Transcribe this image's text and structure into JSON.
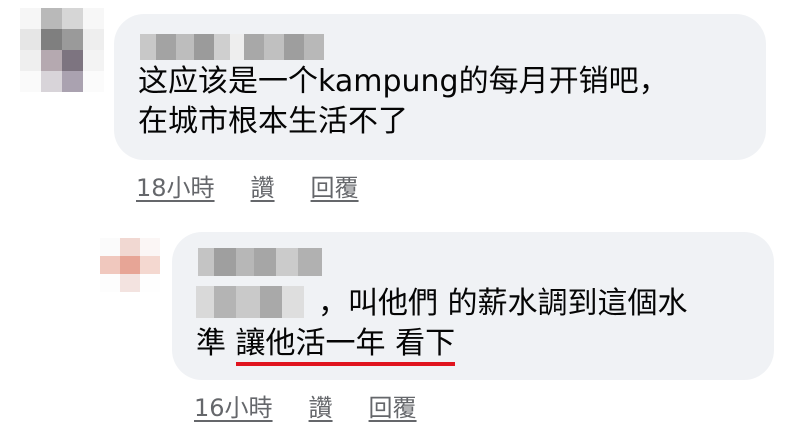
{
  "comments": [
    {
      "text_line1": "这应该是一个kampung的每月开销吧，",
      "text_line2": "在城市根本生活不了",
      "time": "18小時",
      "like_label": "讚",
      "reply_label": "回覆"
    },
    {
      "text_line1_after_mention": "，叫他們 的薪水調到這個水",
      "text_line2_prefix": "準 ",
      "text_line2_underlined": "讓他活一年 看下",
      "time": "16小時",
      "like_label": "讚",
      "reply_label": "回覆"
    }
  ],
  "colors": {
    "bubble_bg": "#f0f2f5",
    "meta_text": "#65676b",
    "underline_highlight": "#e0141e"
  },
  "obscured": [
    "commenter-1-avatar",
    "commenter-1-name",
    "commenter-2-avatar",
    "commenter-2-name",
    "mentioned-user-name"
  ]
}
